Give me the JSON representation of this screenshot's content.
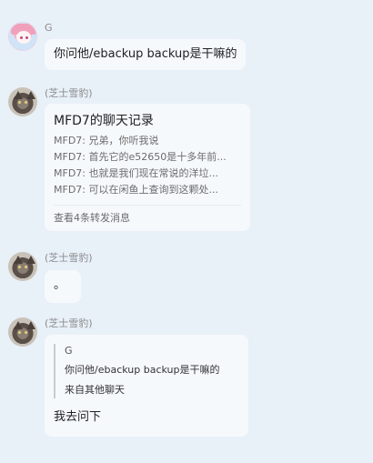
{
  "messages": [
    {
      "sender": "G",
      "text": "你问他/ebackup backup是干嘛的"
    },
    {
      "sender": "(芝士雪豹)",
      "forward": {
        "title": "MFD7的聊天记录",
        "lines": [
          "MFD7: 兄弟，你听我说",
          "MFD7: 首先它的e52650是十多年前...",
          "MFD7: 也就是我们现在常说的洋垃...",
          "MFD7: 可以在闲鱼上查询到这颗处..."
        ],
        "footer": "查看4条转发消息"
      }
    },
    {
      "sender": "(芝士雪豹)",
      "text": "。"
    },
    {
      "sender": "(芝士雪豹)",
      "quote": {
        "name": "G",
        "text": "你问他/ebackup backup是干嘛的",
        "source": "来自其他聊天"
      },
      "reply": "我去问下"
    }
  ]
}
